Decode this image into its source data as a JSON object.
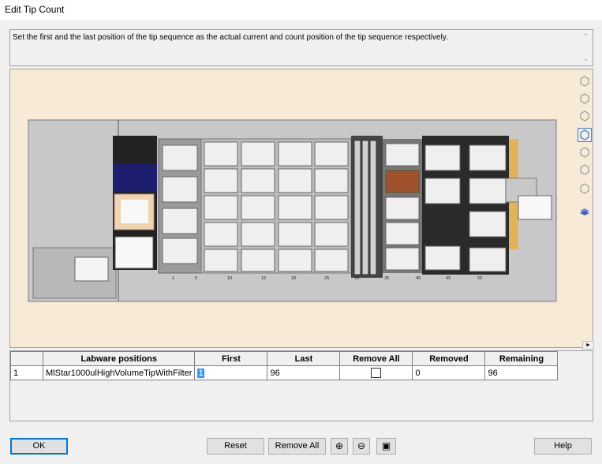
{
  "window": {
    "title": "Edit Tip Count"
  },
  "description": "Set the first and the last position of the tip sequence as the actual  current and count position of the tip sequence respectively.",
  "deck": {
    "track_labels": [
      "1",
      "5",
      "10",
      "15",
      "20",
      "25",
      "30",
      "35",
      "40",
      "45",
      "50"
    ]
  },
  "table": {
    "columns": [
      "Labware positions",
      "First",
      "Last",
      "Remove All",
      "Removed",
      "Remaining"
    ],
    "rows": [
      {
        "index": "1",
        "labware": "MlStar1000ulHighVolumeTipWithFilter",
        "first": "1",
        "last": "96",
        "remove_all": false,
        "removed": "0",
        "remaining": "96"
      }
    ]
  },
  "buttons": {
    "ok": "OK",
    "reset": "Reset",
    "remove_all": "Remove All",
    "help": "Help"
  },
  "icons": {
    "zoom_in": "zoom-in-icon",
    "zoom_out": "zoom-out-icon",
    "fit": "fit-view-icon"
  },
  "colors": {
    "deck_background": "#f7ebd8",
    "deck_gray": "#c8c8c8",
    "selection": "#3399ff",
    "default_button_border": "#0078d7"
  }
}
